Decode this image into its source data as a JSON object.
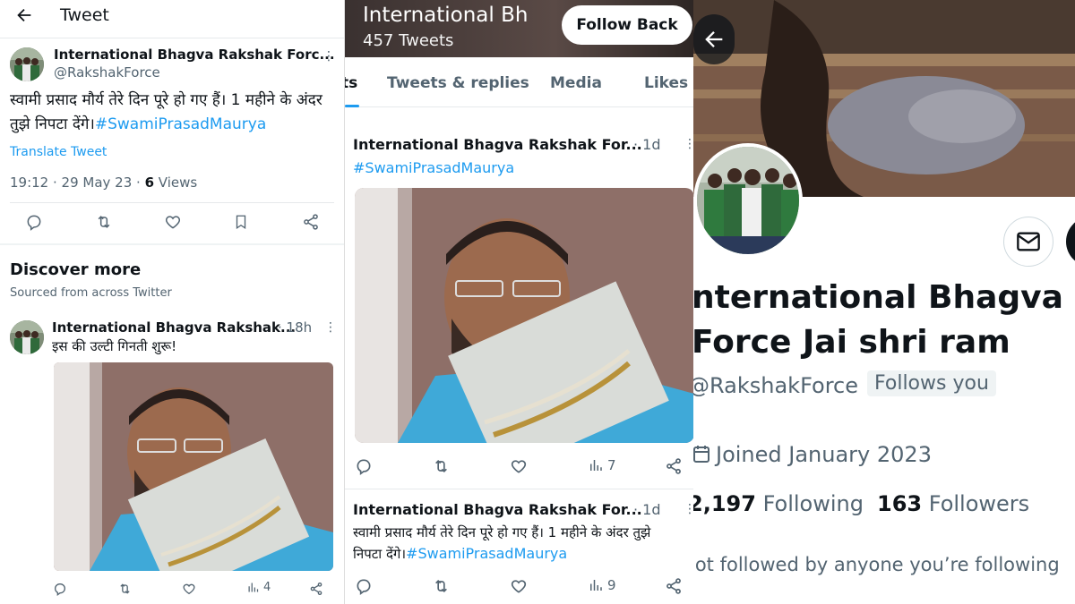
{
  "panel1": {
    "header_title": "Tweet",
    "tweet": {
      "name": "International Bhagva Rakshak Forc...",
      "handle": "@RakshakForce",
      "text": "स्वामी प्रसाद मौर्य तेरे दिन पूरे हो गए हैं। 1 महीने के अंदर तुझे निपटा देंगे।",
      "hashtag": "#SwamiPrasadMaurya",
      "translate": "Translate Tweet",
      "timestamp": "19:12 · 29 May 23 · ",
      "views_count": "6",
      "views_label": " Views"
    },
    "discover_title": "Discover more",
    "discover_subtitle": "Sourced from across Twitter",
    "related": {
      "name": "International Bhagva Rakshak...",
      "time": "· 18h",
      "text": "इस की उल्टी गिनती शुरू!",
      "views": "4"
    }
  },
  "panel2": {
    "header_name": "International Bh",
    "header_tweets": "457 Tweets",
    "follow_back": "Follow Back",
    "tabs": [
      "ts",
      "Tweets & replies",
      "Media",
      "Likes"
    ],
    "tweet1": {
      "name": "International Bhagva Rakshak For...",
      "time": "· 1d",
      "hashtag": "#SwamiPrasadMaurya",
      "views": "7"
    },
    "tweet2": {
      "name": "International Bhagva Rakshak For...",
      "time": "· 1d",
      "text_line1": "स्वामी प्रसाद मौर्य तेरे दिन पूरे हो गए हैं। 1 महीने के अंदर तुझे",
      "text_line2_prefix": "निपटा देंगे।",
      "hashtag": "#SwamiPrasadMaurya",
      "views": "9"
    }
  },
  "panel3": {
    "name_line1": "nternational Bhagva Ra",
    "name_line2": "Force Jai shri ram",
    "handle": "@RakshakForce",
    "follows_you": "Follows you",
    "joined": "Joined January 2023",
    "following_count": "2,197",
    "following_label": "Following",
    "followers_count": "163",
    "followers_label": "Followers",
    "not_followed": "lot followed by anyone you’re following"
  },
  "icons": [
    "back-arrow-icon",
    "reply-icon",
    "retweet-icon",
    "like-icon",
    "bookmark-icon",
    "share-icon",
    "views-icon",
    "more-icon",
    "mail-icon",
    "calendar-icon"
  ],
  "colors": {
    "accent": "#1d9bf0",
    "text": "#0f1419",
    "muted": "#536471",
    "border": "#e6e9eb"
  }
}
